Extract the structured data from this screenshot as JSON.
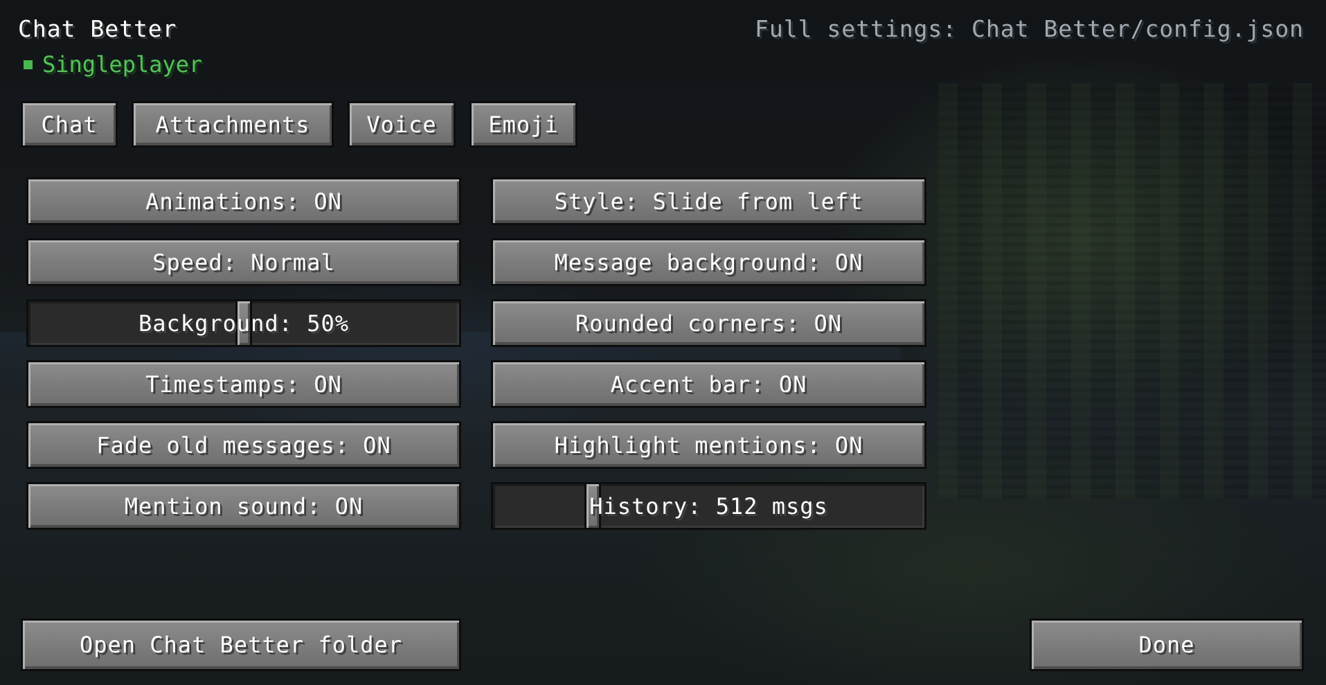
{
  "header": {
    "title": "Chat Better",
    "status": "Singleplayer",
    "settings_path": "Full settings: Chat Better/config.json"
  },
  "tabs": [
    {
      "label": "Chat"
    },
    {
      "label": "Attachments"
    },
    {
      "label": "Voice"
    },
    {
      "label": "Emoji"
    }
  ],
  "settings": {
    "left": [
      {
        "label": "Animations: ON"
      },
      {
        "label": "Speed: Normal"
      },
      {
        "label": "Background: 50%",
        "slider_value": 0.5
      },
      {
        "label": "Timestamps: ON"
      },
      {
        "label": "Fade old messages: ON"
      },
      {
        "label": "Mention sound: ON"
      }
    ],
    "right": [
      {
        "label": "Style: Slide from left"
      },
      {
        "label": "Message background: ON"
      },
      {
        "label": "Rounded corners: ON"
      },
      {
        "label": "Accent bar: ON"
      },
      {
        "label": "Highlight mentions: ON"
      },
      {
        "label": "History: 512 msgs",
        "slider_value": 0.22
      }
    ]
  },
  "footer": {
    "open_folder": "Open Chat Better folder",
    "done": "Done"
  },
  "colors": {
    "status_green": "#55c25a",
    "path_gray": "#a2a9b1",
    "button_gray": "#7b7b7b"
  }
}
